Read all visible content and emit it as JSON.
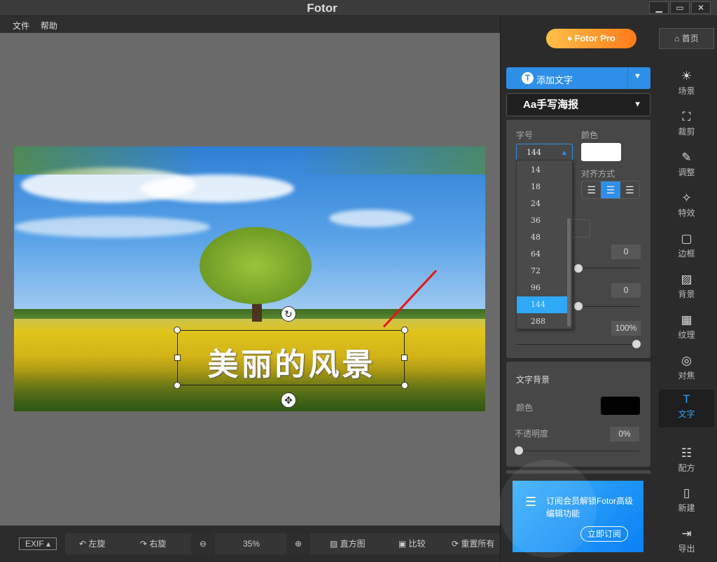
{
  "window": {
    "title": "Fotor",
    "minimize": "▁",
    "maximize": "▭",
    "close": "✕"
  },
  "menu": [
    "文件",
    "帮助"
  ],
  "canvas": {
    "overlay_text": "美丽的风景"
  },
  "bottom": {
    "exif": "EXIF ▴",
    "rotate_left": "左旋",
    "rotate_right": "右旋",
    "zoom": "35%",
    "histogram": "直方图",
    "compare": "比较",
    "reset": "重置所有"
  },
  "header": {
    "pro": "Fotor Pro",
    "home": "首页"
  },
  "text_panel": {
    "add_text": "添加文字",
    "font": "Aa手写海报",
    "size_label": "字号",
    "size_value": "144",
    "color_label": "颜色",
    "color": "#ffffff",
    "align_label": "对齐方式",
    "size_options": [
      "14",
      "18",
      "24",
      "36",
      "48",
      "64",
      "72",
      "96",
      "144",
      "288"
    ],
    "selected_size": "144",
    "value1": "0",
    "value2": "0",
    "opacity": "100%"
  },
  "text_bg": {
    "title": "文字背景",
    "color_label": "颜色",
    "color": "#000000",
    "opacity_label": "不透明度",
    "opacity": "0%"
  },
  "sidebar": [
    {
      "icon": "☀",
      "label": "场景"
    },
    {
      "icon": "⛶",
      "label": "裁剪"
    },
    {
      "icon": "✎",
      "label": "调整"
    },
    {
      "icon": "✧",
      "label": "特效"
    },
    {
      "icon": "▢",
      "label": "边框"
    },
    {
      "icon": "▨",
      "label": "背景"
    },
    {
      "icon": "▦",
      "label": "纹理"
    },
    {
      "icon": "◎",
      "label": "对焦"
    },
    {
      "icon": "T",
      "label": "文字"
    },
    {
      "icon": "☷",
      "label": "配方"
    },
    {
      "icon": "▯",
      "label": "新建"
    },
    {
      "icon": "⇥",
      "label": "导出"
    }
  ],
  "promo": {
    "text": "订阅会员解锁Fotor高级编辑功能",
    "button": "立即订阅"
  }
}
